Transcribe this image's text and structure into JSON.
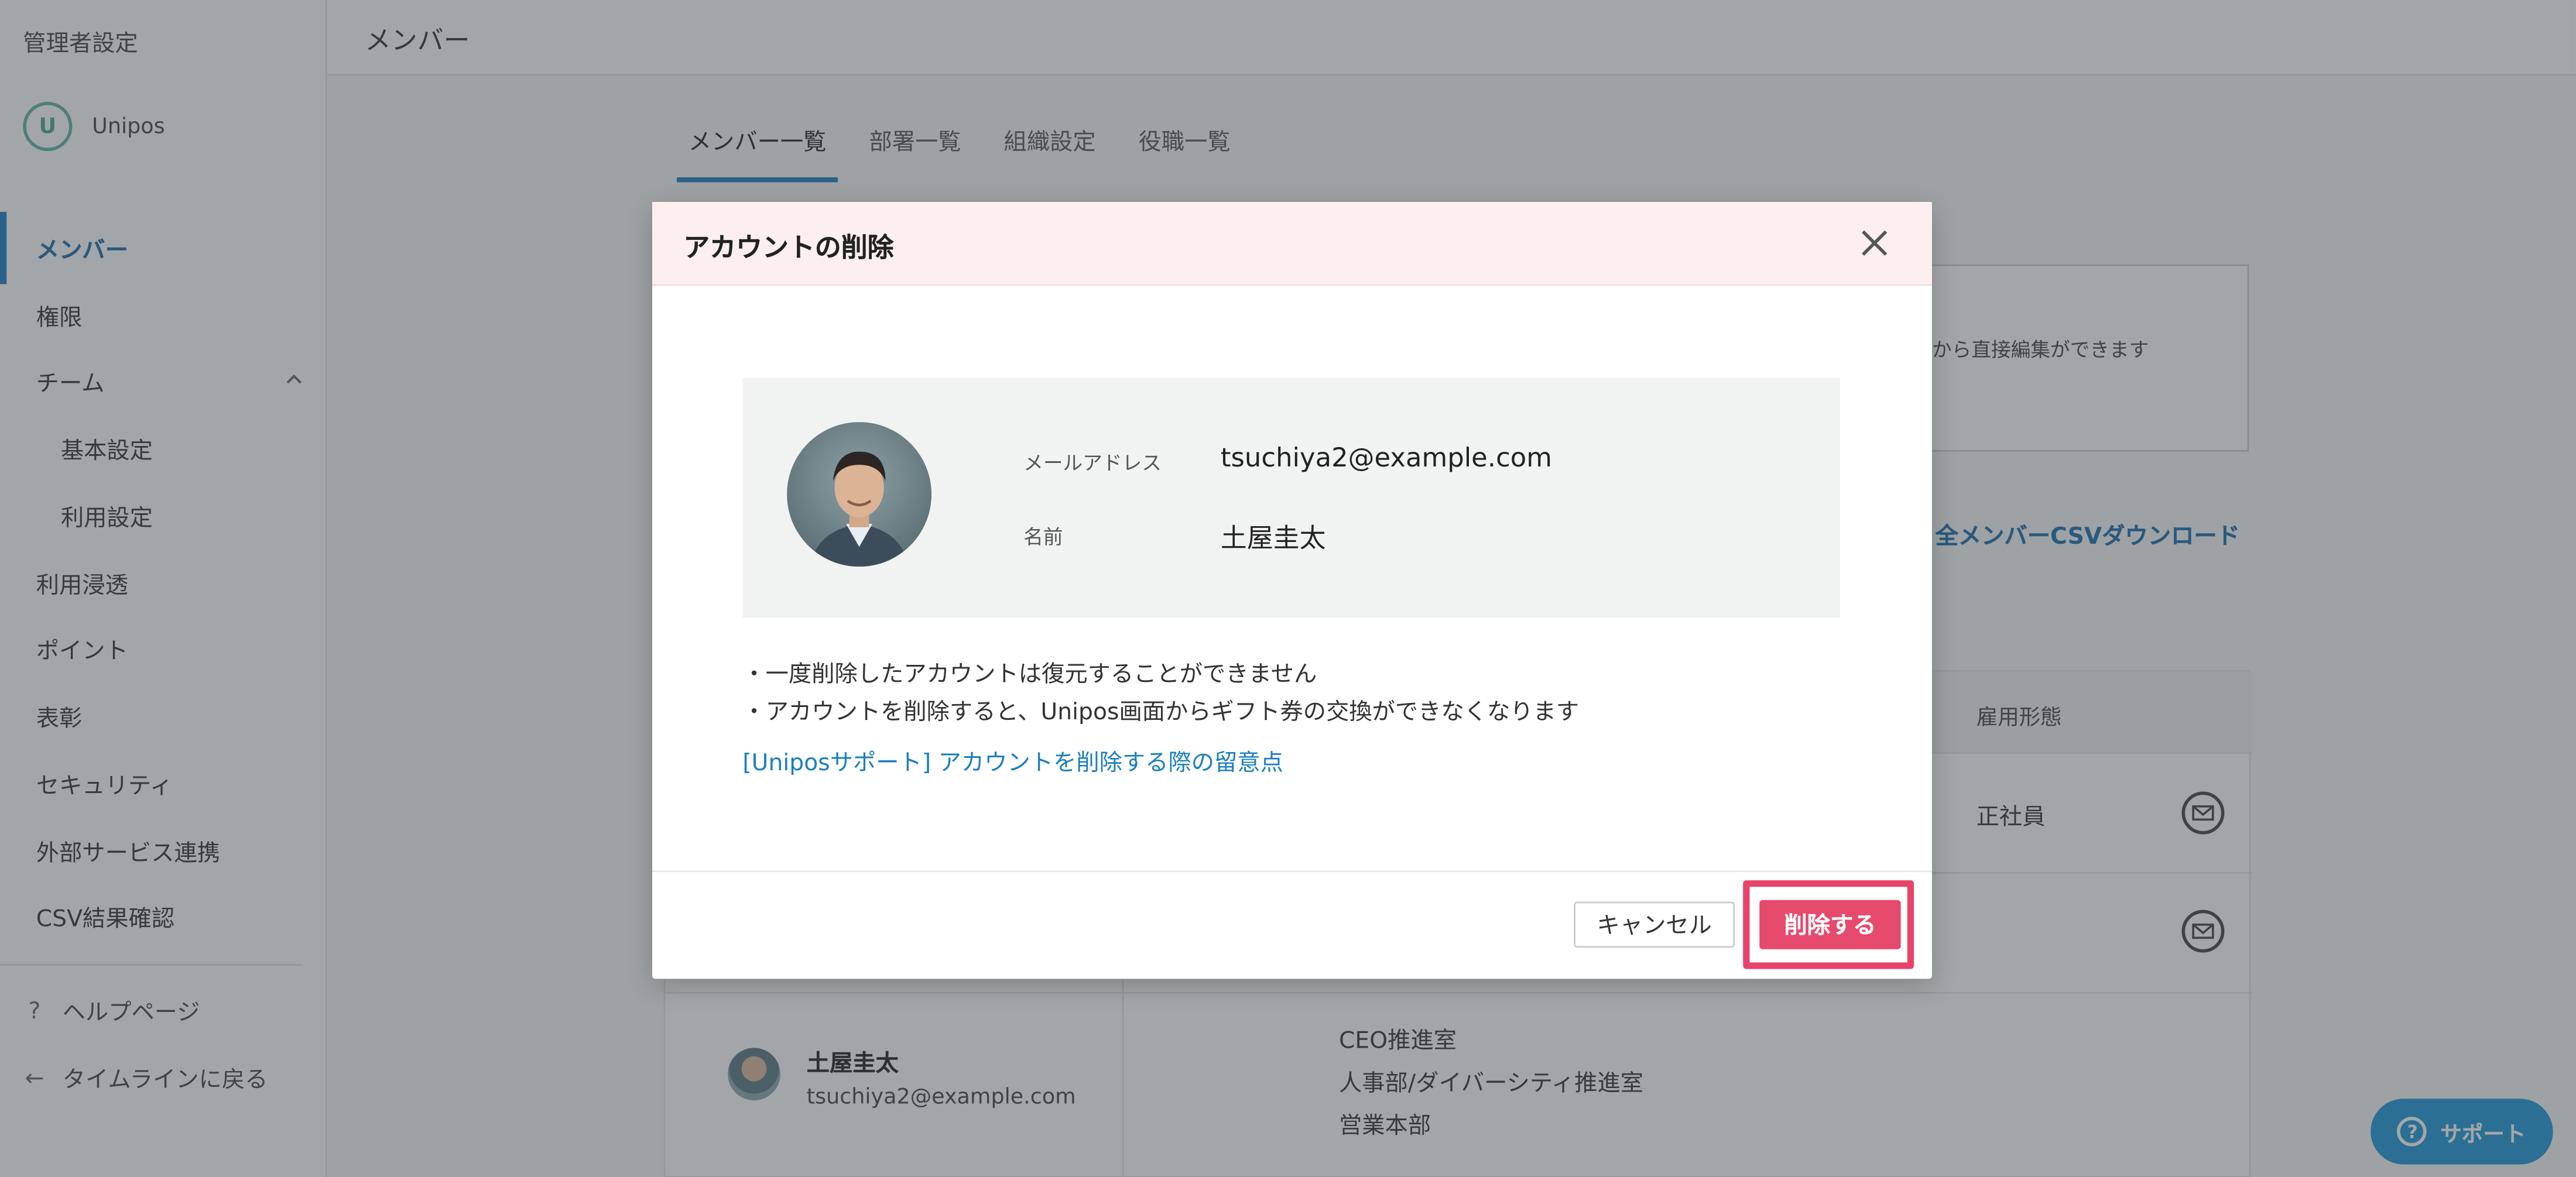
{
  "sidebar": {
    "title": "管理者設定",
    "brand": "Unipos",
    "items": [
      {
        "label": "メンバー"
      },
      {
        "label": "権限"
      },
      {
        "label": "チーム"
      },
      {
        "label": "基本設定"
      },
      {
        "label": "利用設定"
      },
      {
        "label": "利用浸透"
      },
      {
        "label": "ポイント"
      },
      {
        "label": "表彰"
      },
      {
        "label": "セキュリティ"
      },
      {
        "label": "外部サービス連携"
      },
      {
        "label": "CSV結果確認"
      }
    ],
    "help": {
      "icon": "?",
      "label": "ヘルプページ"
    },
    "back": {
      "icon": "←",
      "label": "タイムラインに戻る"
    }
  },
  "header": {
    "title": "メンバー"
  },
  "tabs": [
    {
      "label": "メンバー一覧"
    },
    {
      "label": "部署一覧"
    },
    {
      "label": "組織設定"
    },
    {
      "label": "役職一覧"
    }
  ],
  "info_text": "から直接編集ができます",
  "csv_link": "全メンバーCSVダウンロード",
  "table": {
    "header_employment": "雇用形態",
    "row1_employment": "正社員",
    "member": {
      "name": "土屋圭太",
      "email": "tsuchiya2@example.com",
      "departments": [
        "CEO推進室",
        "人事部/ダイバーシティ推進室",
        "営業本部"
      ]
    }
  },
  "support_button": "サポート",
  "modal": {
    "title": "アカウントの削除",
    "email_label": "メールアドレス",
    "email_value": "tsuchiya2@example.com",
    "name_label": "名前",
    "name_value": "土屋圭太",
    "notice1": "・一度削除したアカウントは復元することができません",
    "notice2": "・アカウントを削除すると、Unipos画面からギフト券の交換ができなくなります",
    "support_link": "[Uniposサポート] アカウントを削除する際の留意点",
    "cancel_label": "キャンセル",
    "delete_label": "削除する"
  },
  "colors": {
    "accent": "#1e7bc4",
    "danger": "#e64a6c",
    "modal_header_bg": "#fdeff0"
  }
}
